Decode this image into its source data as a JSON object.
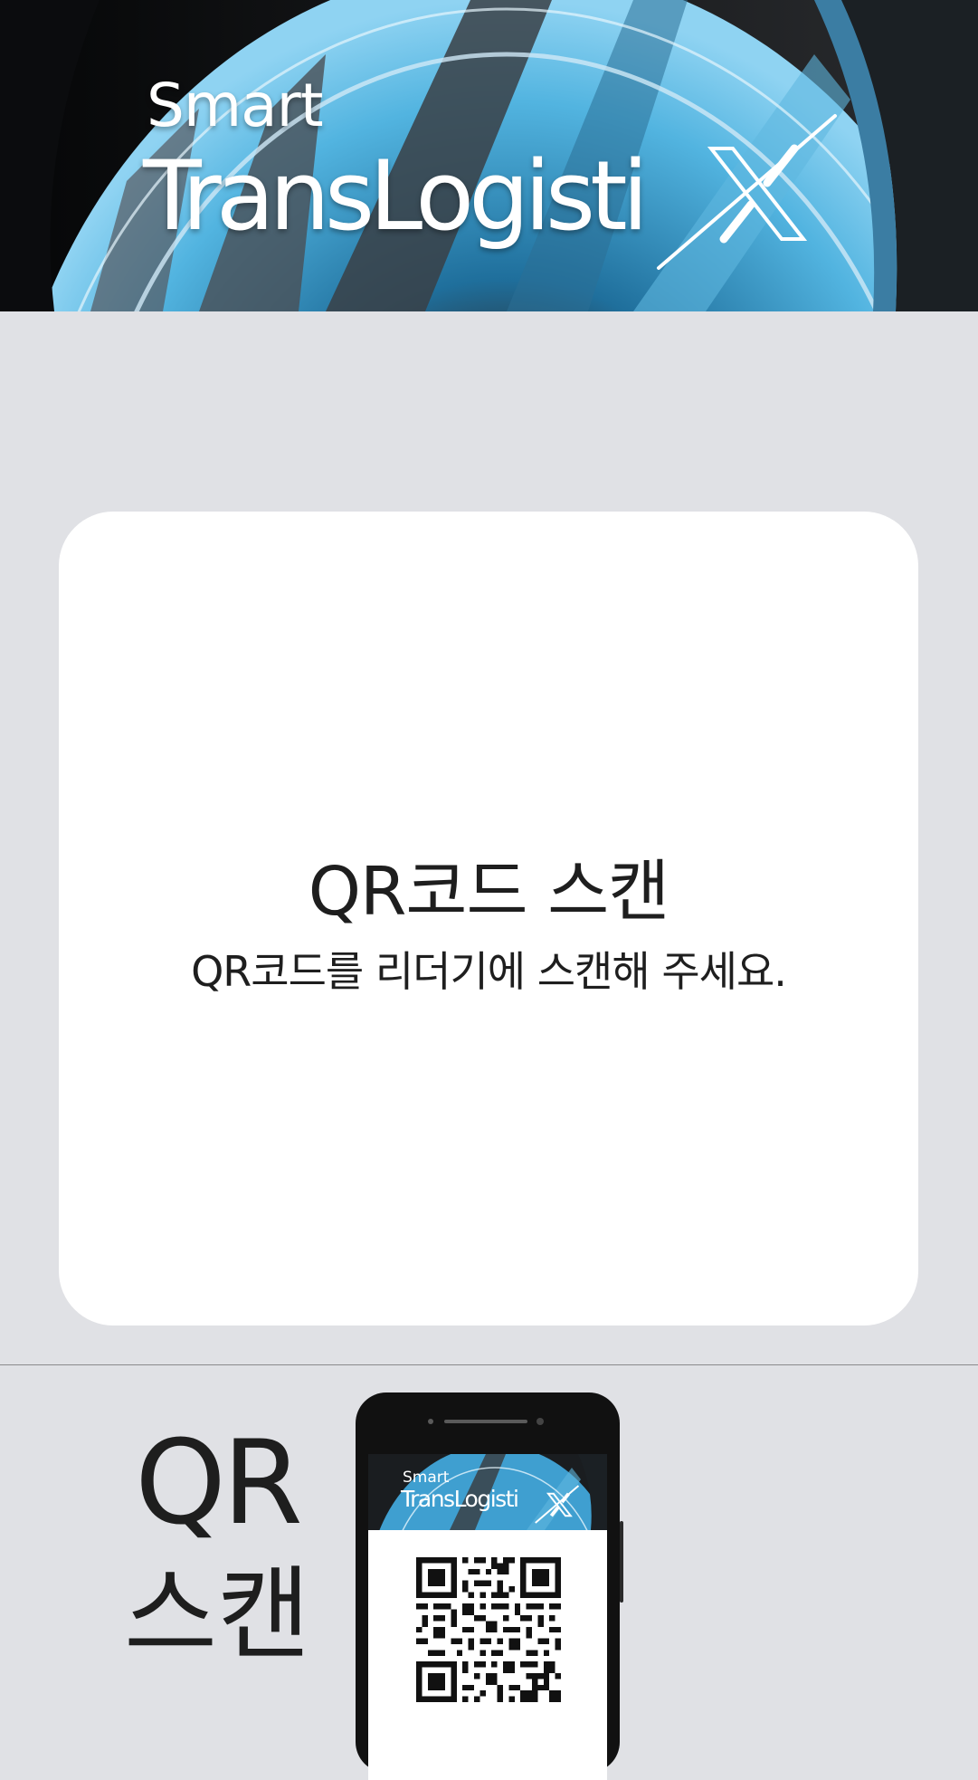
{
  "banner": {
    "logo_smart": "Smart",
    "logo_trans": "TransLogisti",
    "logo_x": "X"
  },
  "card": {
    "title": "QR코드 스캔",
    "subtitle": "QR코드를 리더기에 스캔해 주세요."
  },
  "guide": {
    "big_qr": "QR",
    "big_scan": "스캔",
    "phone_screen": {
      "logo_smart": "Smart",
      "logo_trans": "TransLogisti",
      "logo_x": "X"
    }
  },
  "colors": {
    "background": "#e0e1e5",
    "card": "#ffffff",
    "text": "#1e1e1e",
    "banner_blue": "#3f9fd0"
  },
  "icons": [
    "brand-x-mark-icon",
    "qr-code-icon"
  ]
}
